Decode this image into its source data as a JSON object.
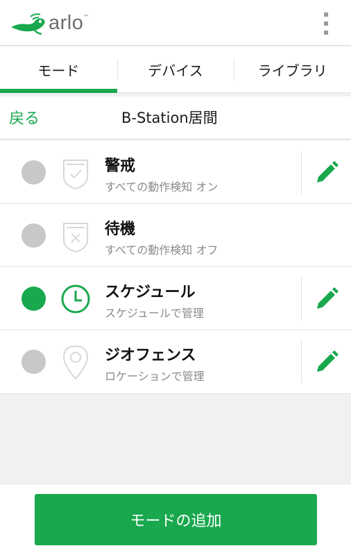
{
  "app": {
    "logo_text": "arlo",
    "logo_tm": "™",
    "menu_icon": "kebab-menu-icon"
  },
  "tabs": [
    {
      "label": "モード",
      "active": true
    },
    {
      "label": "デバイス",
      "active": false
    },
    {
      "label": "ライブラリ",
      "active": false
    }
  ],
  "subheader": {
    "back_label": "戻る",
    "title": "B-Station居間"
  },
  "modes": [
    {
      "title": "警戒",
      "description": "すべての動作検知 オン",
      "selected": false,
      "icon": "shield-check-icon",
      "editable": true
    },
    {
      "title": "待機",
      "description": "すべての動作検知 オフ",
      "selected": false,
      "icon": "shield-x-icon",
      "editable": false
    },
    {
      "title": "スケジュール",
      "description": "スケジュールで管理",
      "selected": true,
      "icon": "clock-icon",
      "editable": true
    },
    {
      "title": "ジオフェンス",
      "description": "ロケーションで管理",
      "selected": false,
      "icon": "location-pin-icon",
      "editable": true
    }
  ],
  "footer": {
    "add_button_label": "モードの追加"
  },
  "colors": {
    "accent": "#19a84e",
    "radio_off": "#c8c8c8",
    "icon_inactive": "#d8d8d8",
    "logo_gray": "#6d6d6d"
  }
}
